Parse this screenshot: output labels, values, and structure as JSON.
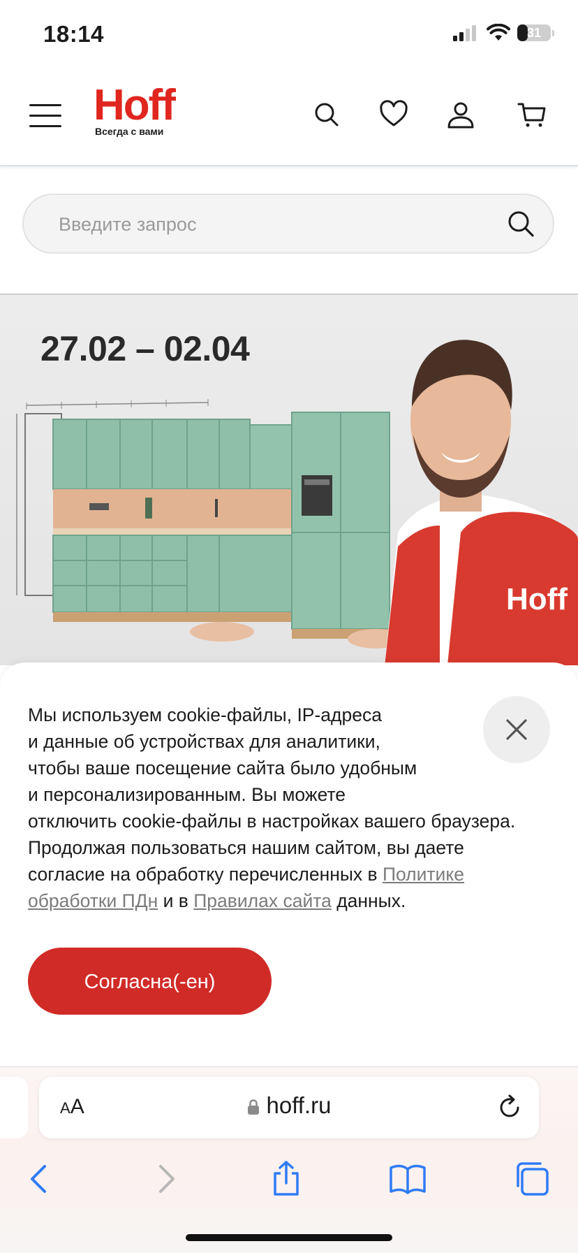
{
  "status_bar": {
    "time": "18:14",
    "battery": "31",
    "battery_level": 0.31
  },
  "header": {
    "logo_word": "Hoff",
    "logo_tagline": "Всегда с вами",
    "icons": [
      "menu-icon",
      "search-icon",
      "heart-icon",
      "user-icon",
      "cart-icon"
    ]
  },
  "search": {
    "placeholder": "Введите запрос",
    "value": ""
  },
  "banner": {
    "dates": "27.02 – 02.04",
    "vest_logo": "Hoff"
  },
  "cookie": {
    "line1": "Мы используем cookie-файлы, IP-адреса",
    "line2": "и данные об устройствах для аналитики,",
    "line3": "чтобы ваше посещение сайта было удобным",
    "line4": "и персонализированным. Вы можете",
    "line5": "отключить cookie-файлы в настройках вашего браузера.",
    "line6": "Продолжая пользоваться нашим сайтом, вы даете",
    "line7_start": "согласие на обработку перечисленных в ",
    "link_policy_1": "Политике",
    "link_policy_2": "обработки ПДн",
    "mid": " и в ",
    "link_rules": "Правилах сайта",
    "end": " данных.",
    "agree_label": "Согласна(-ен)"
  },
  "safari": {
    "text_size_label_small": "A",
    "text_size_label_large": "A",
    "url": "hoff.ru"
  },
  "colors": {
    "brand_red": "#e0261f",
    "button_red": "#d12b27",
    "link_gray": "#7b7b7b"
  }
}
